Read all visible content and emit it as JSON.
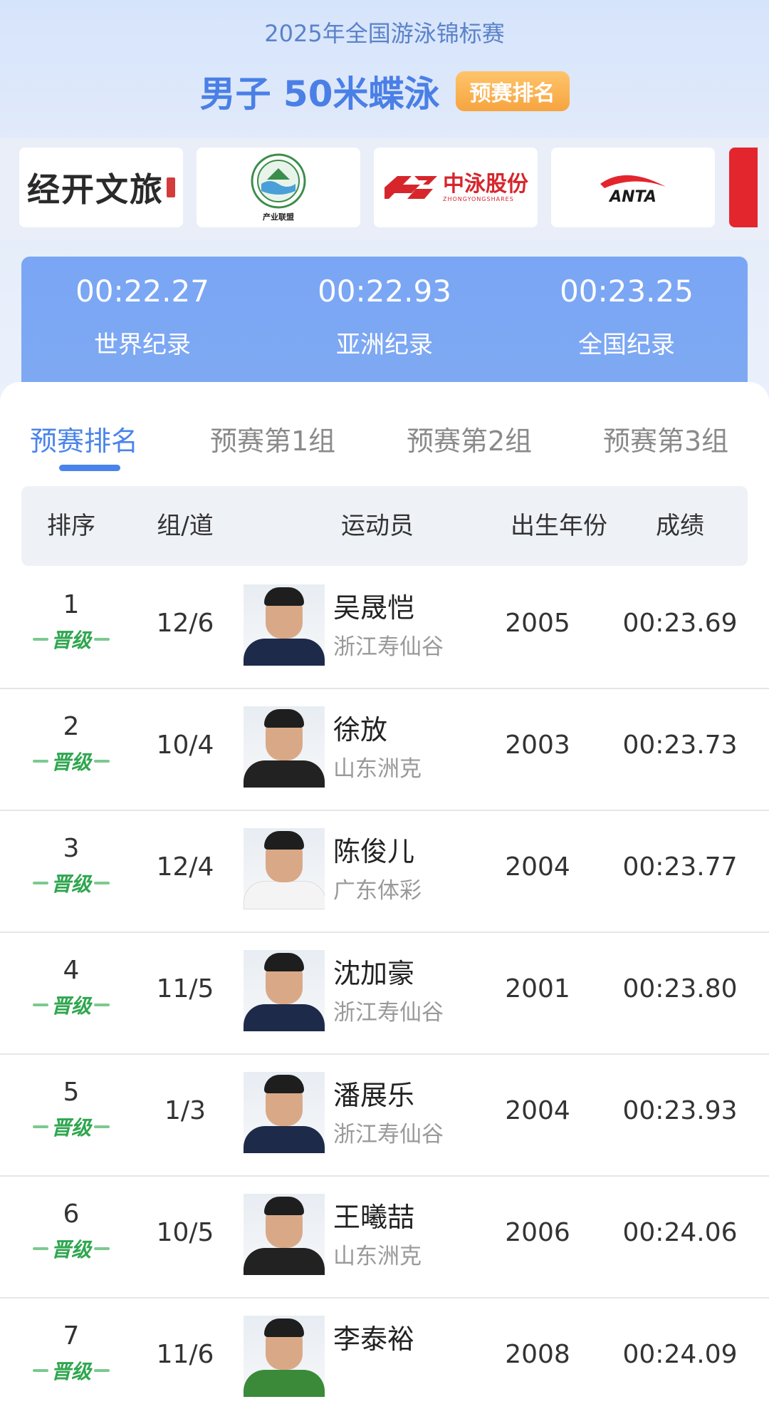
{
  "header": {
    "event_name": "2025年全国游泳锦标赛",
    "title": "男子 50米蝶泳",
    "tag": "预赛排名"
  },
  "sponsors": [
    {
      "name": "经开文旅",
      "icon": "jingkai-wenlv-logo"
    },
    {
      "name": "产业联盟",
      "icon": "industry-alliance-logo"
    },
    {
      "name": "中泳股份",
      "sub": "ZHONGYONGSHARES",
      "icon": "zhongyong-shares-logo"
    },
    {
      "name": "ANTA",
      "icon": "anta-logo"
    }
  ],
  "records": [
    {
      "time": "00:22.27",
      "label": "世界纪录"
    },
    {
      "time": "00:22.93",
      "label": "亚洲纪录"
    },
    {
      "time": "00:23.25",
      "label": "全国纪录"
    }
  ],
  "tabs": [
    "预赛排名",
    "预赛第1组",
    "预赛第2组",
    "预赛第3组"
  ],
  "active_tab": 0,
  "table": {
    "headers": [
      "排序",
      "组/道",
      "运动员",
      "出生年份",
      "成绩"
    ],
    "qualified_label": "晋级",
    "rows": [
      {
        "rank": "1",
        "lane": "12/6",
        "name": "吴晟恺",
        "team": "浙江寿仙谷",
        "year": "2005",
        "score": "00:23.69"
      },
      {
        "rank": "2",
        "lane": "10/4",
        "name": "徐放",
        "team": "山东洲克",
        "year": "2003",
        "score": "00:23.73"
      },
      {
        "rank": "3",
        "lane": "12/4",
        "name": "陈俊儿",
        "team": "广东体彩",
        "year": "2004",
        "score": "00:23.77"
      },
      {
        "rank": "4",
        "lane": "11/5",
        "name": "沈加豪",
        "team": "浙江寿仙谷",
        "year": "2001",
        "score": "00:23.80"
      },
      {
        "rank": "5",
        "lane": "1/3",
        "name": "潘展乐",
        "team": "浙江寿仙谷",
        "year": "2004",
        "score": "00:23.93"
      },
      {
        "rank": "6",
        "lane": "10/5",
        "name": "王曦喆",
        "team": "山东洲克",
        "year": "2006",
        "score": "00:24.06"
      },
      {
        "rank": "7",
        "lane": "11/6",
        "name": "李泰裕",
        "team": "",
        "year": "2008",
        "score": "00:24.09"
      }
    ]
  },
  "colors": {
    "accent": "#4a84ea",
    "tag_orange": "#f6a43f",
    "qualified_green": "#2fa64f",
    "record_bg": "#7aa6f5"
  }
}
